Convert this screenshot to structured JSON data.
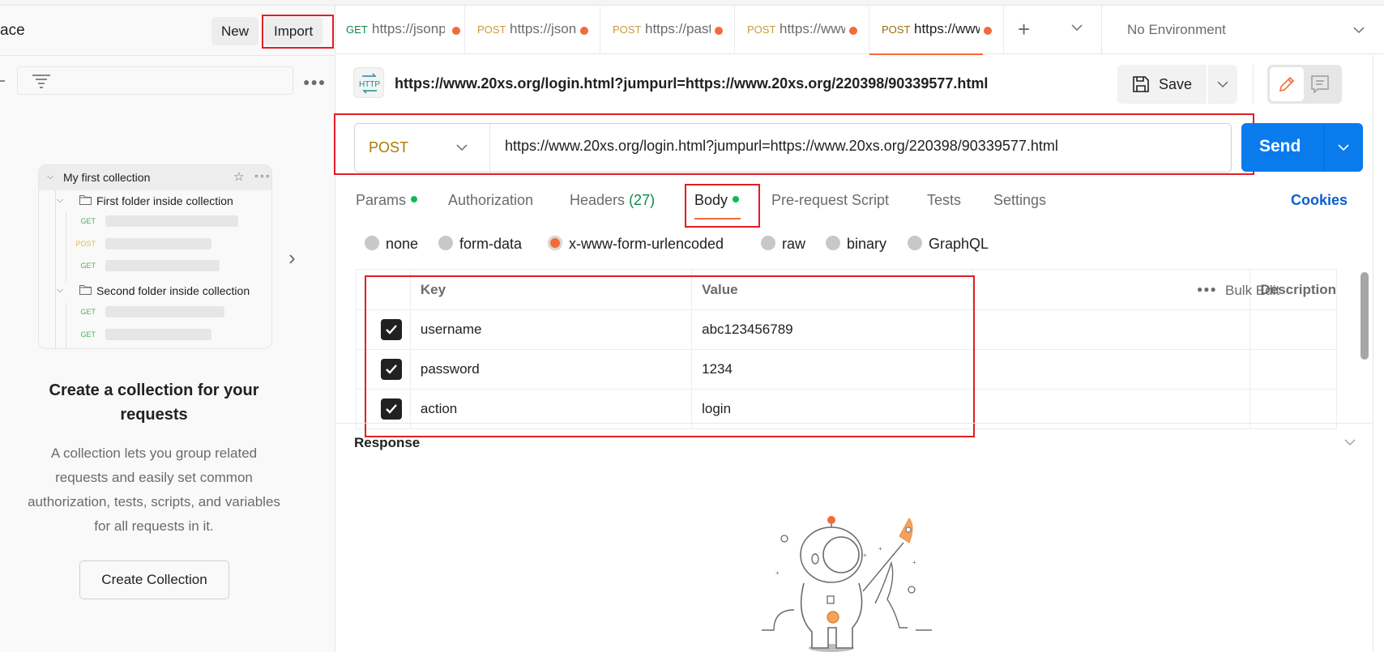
{
  "sidebar": {
    "workspace_title_partial": "ace",
    "new_label": "New",
    "import_label": "Import",
    "collection": {
      "name": "My first collection",
      "folders": [
        {
          "name": "First folder inside collection",
          "requests": [
            "GET",
            "POST",
            "GET"
          ]
        },
        {
          "name": "Second folder inside collection",
          "requests": [
            "GET",
            "GET"
          ]
        }
      ]
    },
    "empty_title": "Create a collection for your requests",
    "empty_description": "A collection lets you group related requests and easily set common authorization, tests, scripts, and variables for all requests in it.",
    "create_button": "Create Collection"
  },
  "tabs": [
    {
      "method": "GET",
      "url": "https://jsonplaceholder",
      "unsaved": true,
      "active": false
    },
    {
      "method": "POST",
      "url": "https://jsonplaceholder",
      "unsaved": true,
      "active": false
    },
    {
      "method": "POST",
      "url": "https://pastebin",
      "unsaved": true,
      "active": false
    },
    {
      "method": "POST",
      "url": "https://www",
      "unsaved": true,
      "active": false
    },
    {
      "method": "POST",
      "url": "https://www",
      "unsaved": true,
      "active": true
    }
  ],
  "environment": "No Environment",
  "request": {
    "title": "https://www.20xs.org/login.html?jumpurl=https://www.20xs.org/220398/90339577.html",
    "method": "POST",
    "url": "https://www.20xs.org/login.html?jumpurl=https://www.20xs.org/220398/90339577.html",
    "save_label": "Save",
    "send_label": "Send"
  },
  "request_tabs": {
    "params": "Params",
    "authorization": "Authorization",
    "headers": "Headers",
    "headers_count": "(27)",
    "body": "Body",
    "prerequest": "Pre-request Script",
    "tests": "Tests",
    "settings": "Settings",
    "cookies": "Cookies"
  },
  "body_types": [
    {
      "label": "none",
      "selected": false
    },
    {
      "label": "form-data",
      "selected": false
    },
    {
      "label": "x-www-form-urlencoded",
      "selected": true
    },
    {
      "label": "raw",
      "selected": false
    },
    {
      "label": "binary",
      "selected": false
    },
    {
      "label": "GraphQL",
      "selected": false
    }
  ],
  "params_table": {
    "headers": {
      "key": "Key",
      "value": "Value",
      "description": "Description",
      "bulk_edit": "Bulk Edit"
    },
    "rows": [
      {
        "checked": true,
        "key": "username",
        "value": "abc123456789",
        "description": ""
      },
      {
        "checked": true,
        "key": "password",
        "value": "1234",
        "description": ""
      },
      {
        "checked": true,
        "key": "action",
        "value": "login",
        "description": ""
      }
    ]
  },
  "response": {
    "title": "Response"
  },
  "colors": {
    "accent_orange": "#f26b3a",
    "send_blue": "#097bed",
    "get_green": "#0a8a4e",
    "post_gold": "#ad7a03",
    "highlight_red": "#e31e24"
  }
}
